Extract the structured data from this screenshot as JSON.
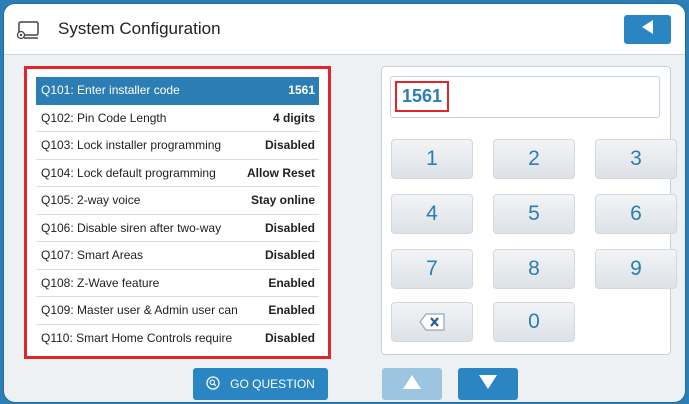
{
  "header": {
    "title": "System Configuration",
    "back_icon": "back-arrow-icon",
    "settings_icon": "system-config-icon"
  },
  "questions": [
    {
      "label": "Q101: Enter installer code",
      "value": "1561",
      "selected": true
    },
    {
      "label": "Q102: Pin Code Length",
      "value": "4 digits"
    },
    {
      "label": "Q103: Lock installer programming",
      "value": "Disabled"
    },
    {
      "label": "Q104: Lock default programming",
      "value": "Allow Reset"
    },
    {
      "label": "Q105: 2-way voice",
      "value": "Stay online"
    },
    {
      "label": "Q106: Disable siren after two-way",
      "value": "Disabled"
    },
    {
      "label": "Q107: Smart Areas",
      "value": "Disabled"
    },
    {
      "label": "Q108: Z-Wave feature",
      "value": "Enabled"
    },
    {
      "label": "Q109: Master user & Admin user can",
      "value": "Enabled"
    },
    {
      "label": "Q110: Smart Home Controls require",
      "value": "Disabled"
    }
  ],
  "keypad": {
    "display": "1561",
    "keys": [
      "1",
      "2",
      "3",
      "4",
      "5",
      "6",
      "7",
      "8",
      "9",
      "0"
    ],
    "backspace_icon": "backspace-icon"
  },
  "footer": {
    "go_label": "GO QUESTION",
    "go_icon": "search-icon",
    "up_icon": "up-arrow-icon",
    "down_icon": "down-arrow-icon"
  },
  "colors": {
    "accent": "#2a86c3",
    "highlight": "#e0262b",
    "selected_row": "#2b7db3"
  }
}
